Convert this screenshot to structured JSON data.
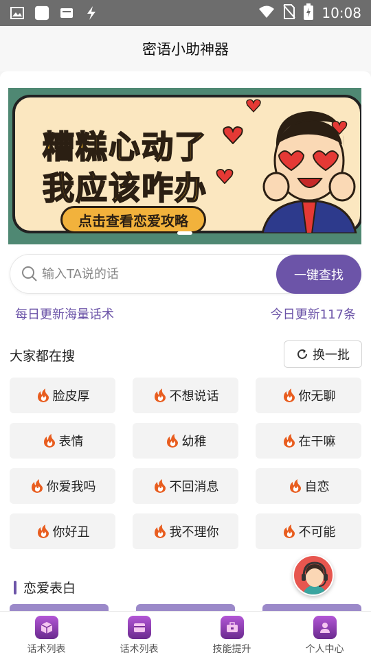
{
  "status": {
    "time": "10:08"
  },
  "app": {
    "title": "密语小助神器"
  },
  "banner": {
    "line1": "糟糕心动了",
    "line2": "我应该咋办",
    "pill": "点击查看恋爱攻略"
  },
  "search": {
    "placeholder": "输入TA说的话",
    "button": "一键查找"
  },
  "info": {
    "left": "每日更新海量话术",
    "right": "今日更新117条"
  },
  "popular": {
    "title": "大家都在搜",
    "refresh": "换一批",
    "tags": [
      "脸皮厚",
      "不想说话",
      "你无聊",
      "表情",
      "幼稚",
      "在干嘛",
      "你爱我吗",
      "不回消息",
      "自恋",
      "你好丑",
      "我不理你",
      "不可能"
    ]
  },
  "love": {
    "title": "恋爱表白"
  },
  "nav": {
    "items": [
      {
        "label": "话术列表",
        "icon": "box-icon"
      },
      {
        "label": "话术列表",
        "icon": "card-icon"
      },
      {
        "label": "技能提升",
        "icon": "toolbox-icon"
      },
      {
        "label": "个人中心",
        "icon": "person-icon"
      }
    ]
  },
  "colors": {
    "accent": "#6c54a8",
    "statusbar": "#6d6d6d",
    "fire": "#e85d1f",
    "fab": "#e7564f"
  }
}
